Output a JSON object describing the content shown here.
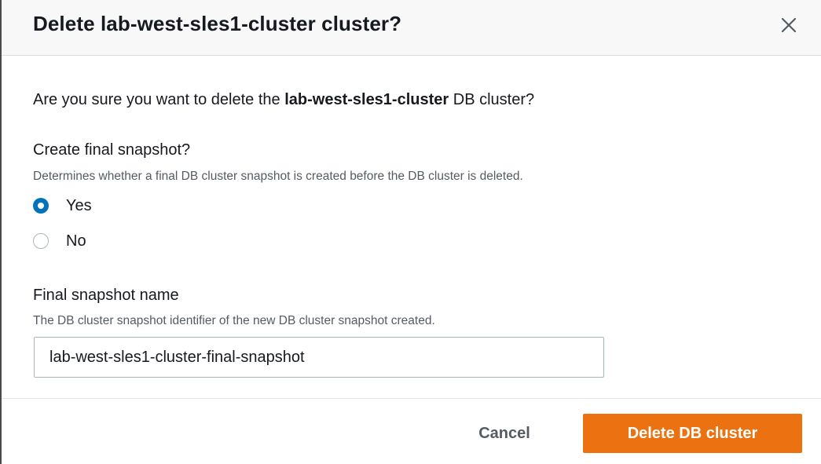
{
  "modal": {
    "title": "Delete lab-west-sles1-cluster cluster?",
    "close_icon": "close-icon"
  },
  "body": {
    "confirm_prefix": "Are you sure you want to delete the ",
    "confirm_cluster": "lab-west-sles1-cluster",
    "confirm_suffix": " DB cluster?"
  },
  "snapshot": {
    "label": "Create final snapshot?",
    "description": "Determines whether a final DB cluster snapshot is created before the DB cluster is deleted.",
    "options": [
      {
        "label": "Yes",
        "selected": true
      },
      {
        "label": "No",
        "selected": false
      }
    ]
  },
  "snapshot_name": {
    "label": "Final snapshot name",
    "description": "The DB cluster snapshot identifier of the new DB cluster snapshot created.",
    "value": "lab-west-sles1-cluster-final-snapshot"
  },
  "footer": {
    "cancel_label": "Cancel",
    "delete_label": "Delete DB cluster"
  },
  "colors": {
    "primary": "#ec7211",
    "radio_selected": "#0073bb",
    "text": "#16191f",
    "secondary_text": "#545b64"
  }
}
